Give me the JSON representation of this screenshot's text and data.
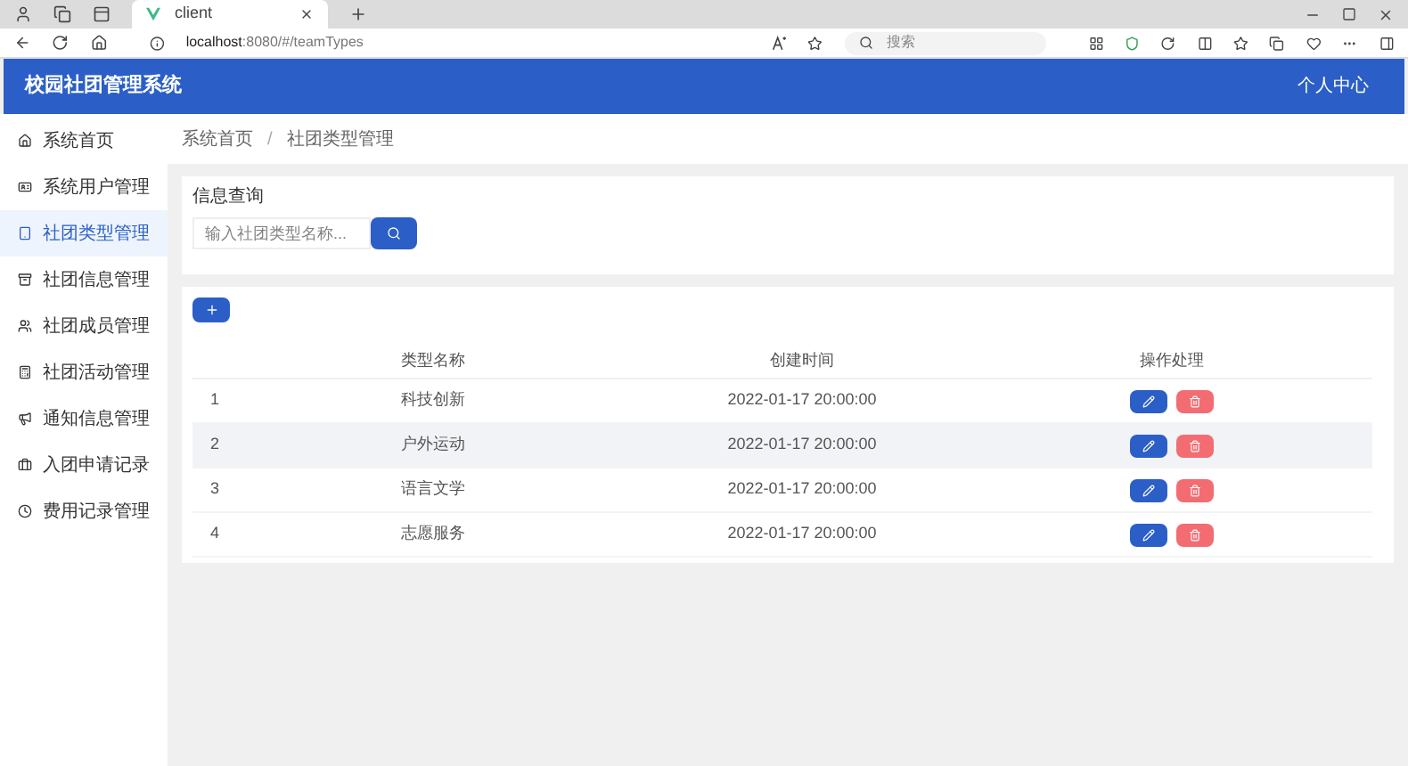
{
  "browser": {
    "tab_title": "client",
    "url_host": "localhost",
    "url_path": ":8080/#/teamTypes",
    "search_placeholder": "搜索"
  },
  "header": {
    "title": "校园社团管理系统",
    "user_menu": "个人中心"
  },
  "sidebar": {
    "items": [
      {
        "label": "系统首页",
        "selected": false
      },
      {
        "label": "系统用户管理",
        "selected": false
      },
      {
        "label": "社团类型管理",
        "selected": true
      },
      {
        "label": "社团信息管理",
        "selected": false
      },
      {
        "label": "社团成员管理",
        "selected": false
      },
      {
        "label": "社团活动管理",
        "selected": false
      },
      {
        "label": "通知信息管理",
        "selected": false
      },
      {
        "label": "入团申请记录",
        "selected": false
      },
      {
        "label": "费用记录管理",
        "selected": false
      }
    ]
  },
  "breadcrumb": [
    "系统首页",
    "社团类型管理"
  ],
  "breadcrumb_separator": "/",
  "query": {
    "title": "信息查询",
    "placeholder": "输入社团类型名称..."
  },
  "table": {
    "columns": [
      "类型名称",
      "创建时间",
      "操作处理"
    ],
    "rows": [
      {
        "index": "1",
        "name": "科技创新",
        "created": "2022-01-17 20:00:00",
        "hovered": false
      },
      {
        "index": "2",
        "name": "户外运动",
        "created": "2022-01-17 20:00:00",
        "hovered": true
      },
      {
        "index": "3",
        "name": "语言文学",
        "created": "2022-01-17 20:00:00",
        "hovered": false
      },
      {
        "index": "4",
        "name": "志愿服务",
        "created": "2022-01-17 20:00:00",
        "hovered": false
      }
    ]
  }
}
